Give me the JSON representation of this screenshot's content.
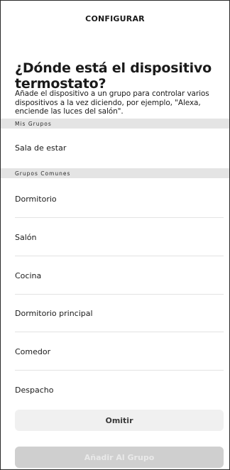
{
  "header": {
    "title": "CONFIGURAR"
  },
  "main": {
    "heading": "¿Dónde está el dispositivo termostato?",
    "description": "Añade el dispositivo a un grupo para controlar varios dispositivos a la vez diciendo, por ejemplo, \"Alexa, enciende las luces del salón\"."
  },
  "my_groups": {
    "section_label": "Mis Grupos",
    "items": [
      "Sala de estar"
    ]
  },
  "common_groups": {
    "section_label": "Grupos Comunes",
    "items": [
      "Dormitorio",
      "Salón",
      "Cocina",
      "Dormitorio principal",
      "Comedor",
      "Despacho"
    ]
  },
  "actions": {
    "skip_label": "Omitir",
    "add_label": "Añadir Al Grupo"
  }
}
